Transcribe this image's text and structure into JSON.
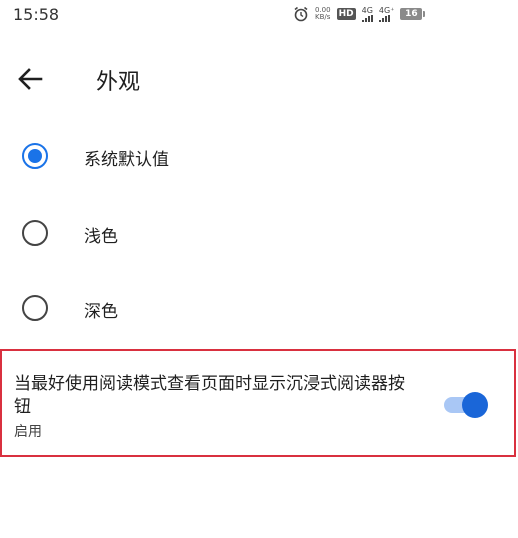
{
  "status_bar": {
    "time": "15:58",
    "speed_value": "0.00",
    "speed_unit": "KB/s",
    "hd_label": "HD",
    "network_1": "4G",
    "network_2": "4G⁺",
    "battery": "16"
  },
  "header": {
    "title": "外观"
  },
  "theme_options": [
    {
      "label": "系统默认值",
      "checked": true
    },
    {
      "label": "浅色",
      "checked": false
    },
    {
      "label": "深色",
      "checked": false
    }
  ],
  "reader_mode_setting": {
    "title": "当最好使用阅读模式查看页面时显示沉浸式阅读器按钮",
    "summary": "启用",
    "enabled": true
  },
  "colors": {
    "accent": "#1a73e8",
    "highlight_border": "#d9303f"
  }
}
